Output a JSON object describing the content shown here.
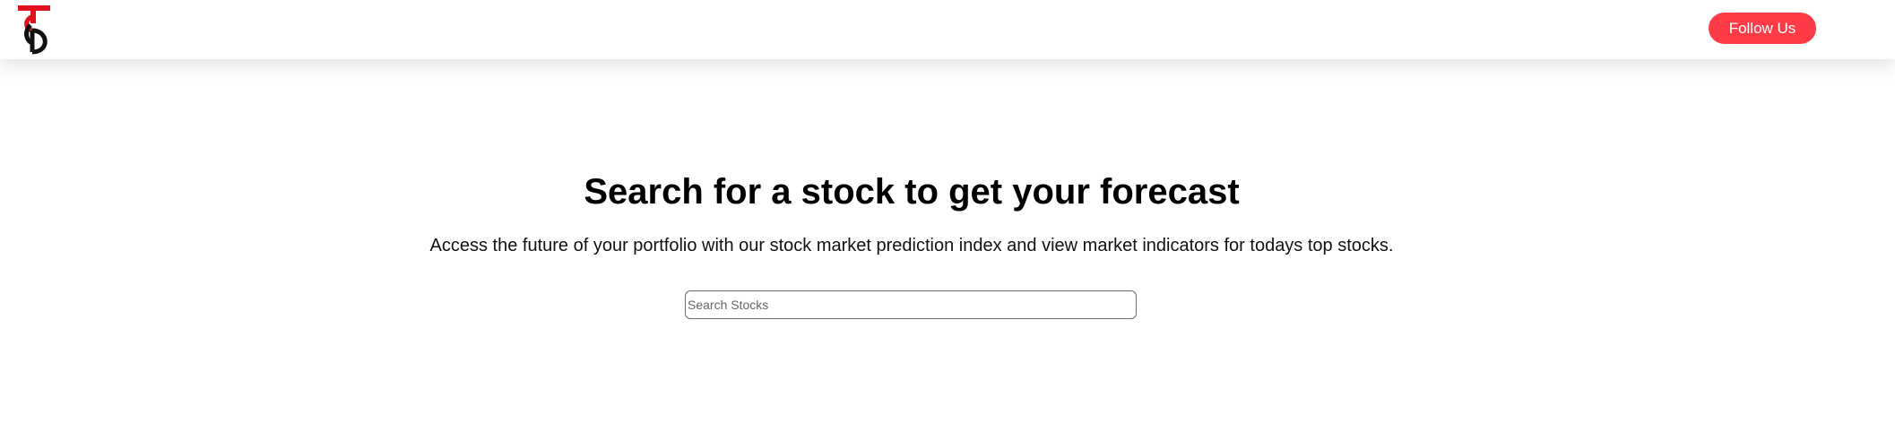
{
  "header": {
    "logo_name": "ts-logo",
    "follow_label": "Follow Us"
  },
  "hero": {
    "title": "Search for a stock to get your forecast",
    "subtitle": "Access the future of your portfolio with our stock market prediction index and view market indicators for todays top stocks."
  },
  "search": {
    "placeholder": "Search Stocks",
    "value": ""
  },
  "colors": {
    "accent": "#ff3b47",
    "logo_red": "#e3101e",
    "logo_black": "#111111"
  }
}
